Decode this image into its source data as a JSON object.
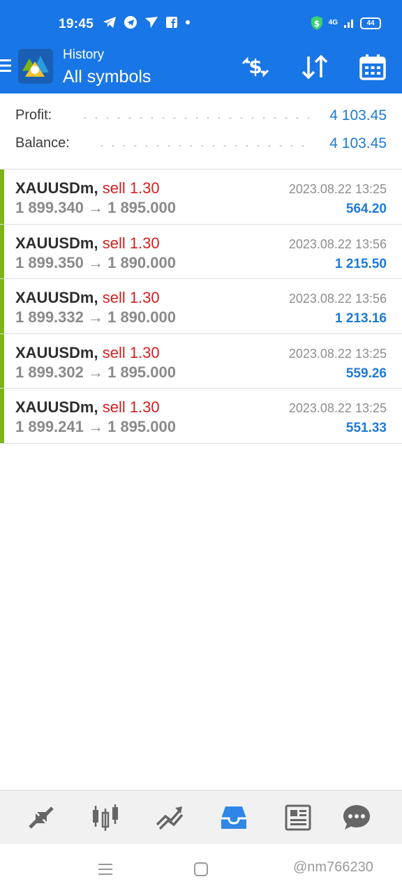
{
  "status_bar": {
    "time": "19:45",
    "network": "4G",
    "battery": "44",
    "icons_left": [
      "telegram-icon",
      "telegram-circle-icon",
      "send-icon",
      "facebook-icon",
      "dot-icon"
    ],
    "icons_right": [
      "shield-dollar-icon",
      "signal-icon",
      "battery-icon"
    ]
  },
  "app_bar": {
    "subtitle": "History",
    "title": "All symbols",
    "actions": [
      "currency-exchange-icon",
      "sort-icon",
      "calendar-icon"
    ]
  },
  "summary": {
    "profit_label": "Profit:",
    "profit_value": "4 103.45",
    "balance_label": "Balance:",
    "balance_value": "4 103.45"
  },
  "deals": [
    {
      "symbol": "XAUUSDm,",
      "side": "sell 1.30",
      "prices": "1 899.340 → 1 895.000",
      "time": "2023.08.22 13:25",
      "profit": "564.20"
    },
    {
      "symbol": "XAUUSDm,",
      "side": "sell 1.30",
      "prices": "1 899.350 → 1 890.000",
      "time": "2023.08.22 13:56",
      "profit": "1 215.50"
    },
    {
      "symbol": "XAUUSDm,",
      "side": "sell 1.30",
      "prices": "1 899.332 → 1 890.000",
      "time": "2023.08.22 13:56",
      "profit": "1 213.16"
    },
    {
      "symbol": "XAUUSDm,",
      "side": "sell 1.30",
      "prices": "1 899.302 → 1 895.000",
      "time": "2023.08.22 13:25",
      "profit": "559.26"
    },
    {
      "symbol": "XAUUSDm,",
      "side": "sell 1.30",
      "prices": "1 899.241 → 1 895.000",
      "time": "2023.08.22 13:25",
      "profit": "551.33"
    }
  ],
  "bottom_nav": {
    "items": [
      "quotes-icon",
      "chart-icon",
      "trade-icon",
      "history-icon",
      "news-icon",
      "messages-icon"
    ],
    "active": "history-icon"
  },
  "colors": {
    "primary": "#1976e6",
    "accent_bar": "#7fb414",
    "sell": "#d21f1f",
    "profit": "#1d7ad8"
  },
  "watermark": "@nm766230"
}
